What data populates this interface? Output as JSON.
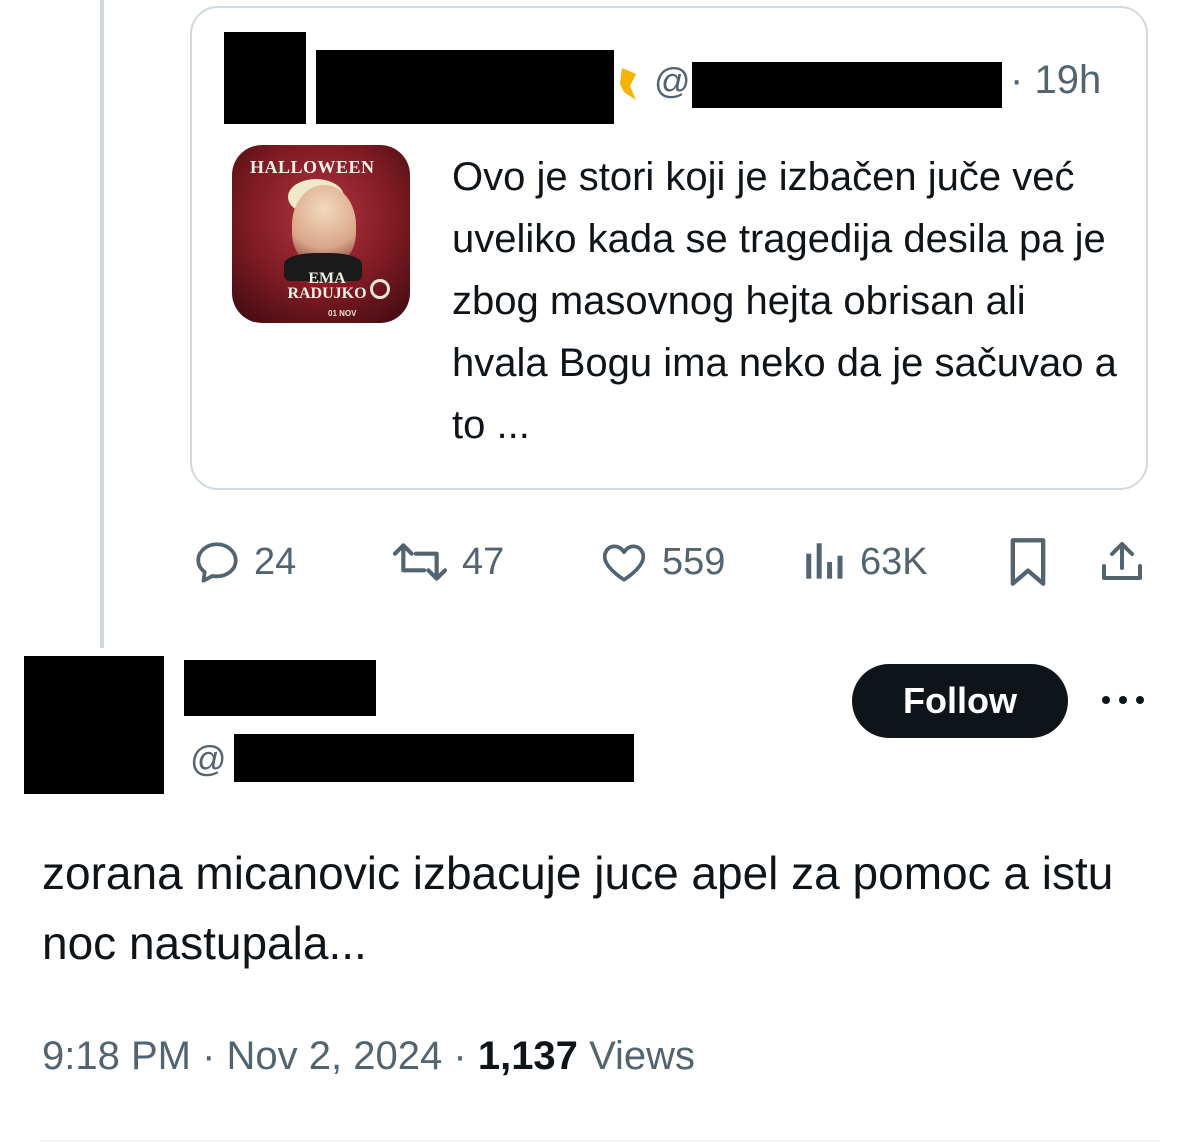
{
  "quoted_tweet": {
    "handle_prefix": "@",
    "separator": "·",
    "time": "19h",
    "thumbnail": {
      "title": "HALLOWEEN",
      "artist": "EMA RADUJKO",
      "date": "01 NOV"
    },
    "text": "Ovo je stori koji je izbačen juče već uveliko kada se tragedija desila pa je zbog masovnog hejta obrisan ali hvala Bogu ima neko da je sačuvao a to ..."
  },
  "actions": {
    "replies": "24",
    "reposts": "47",
    "likes": "559",
    "views": "63K",
    "icons": [
      "reply-icon",
      "repost-icon",
      "like-icon",
      "views-icon",
      "bookmark-icon",
      "share-icon"
    ]
  },
  "reply_tweet": {
    "handle_prefix": "@",
    "follow_label": "Follow",
    "more_label": "•••",
    "text": "zorana micanovic izbacuje juce apel za pomoc a istu noc nastupala...",
    "time": "9:18 PM",
    "sep1": "·",
    "date": "Nov 2, 2024",
    "sep2": "·",
    "views_count": "1,137",
    "views_label": "Views"
  },
  "colors": {
    "text": "#0f1419",
    "muted": "#536471",
    "border": "#cfd9de",
    "button": "#0f1419"
  }
}
